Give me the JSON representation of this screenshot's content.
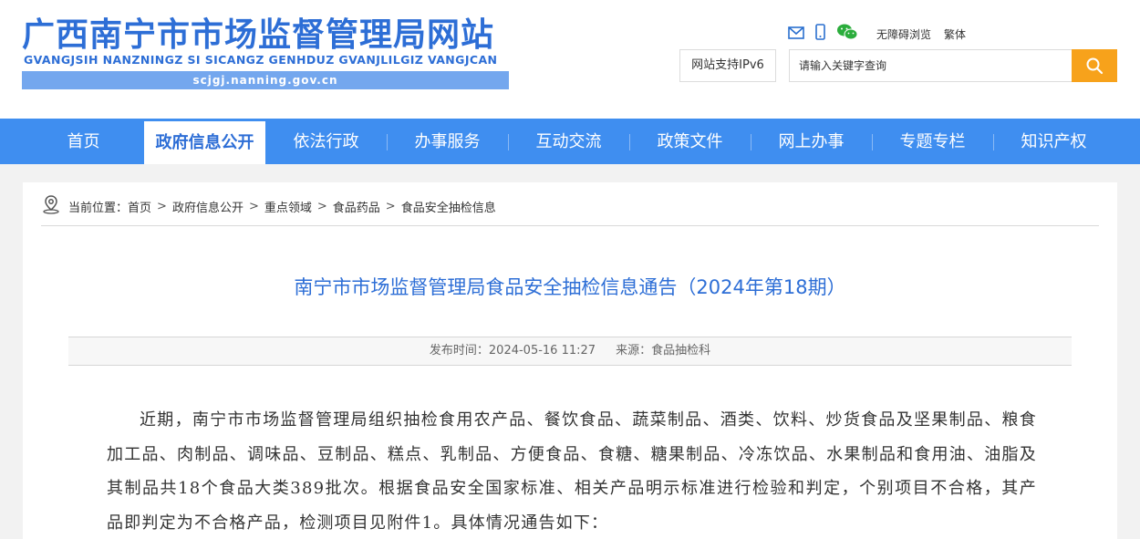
{
  "header": {
    "site_title": "广西南宁市市场监督管理局网站",
    "site_pinyin": "GVANGJSIH NANZNINGZ SI SICANGZ GENHDUZ GVANJLILGIZ VANGJCAN",
    "site_domain": "scjgj.nanning.gov.cn",
    "icons": [
      "mail-icon",
      "mobile-icon",
      "wechat-icon"
    ],
    "accessibility_label": "无障碍浏览",
    "traditional_label": "繁体",
    "ipv6_label": "网站支持IPv6",
    "search_placeholder": "请输入关键字查询"
  },
  "nav": {
    "items": [
      {
        "label": "首页",
        "active": false
      },
      {
        "label": "政府信息公开",
        "active": true
      },
      {
        "label": "依法行政",
        "active": false
      },
      {
        "label": "办事服务",
        "active": false
      },
      {
        "label": "互动交流",
        "active": false
      },
      {
        "label": "政策文件",
        "active": false
      },
      {
        "label": "网上办事",
        "active": false
      },
      {
        "label": "专题专栏",
        "active": false
      },
      {
        "label": "知识产权",
        "active": false
      }
    ]
  },
  "breadcrumb": {
    "prefix": "当前位置：",
    "items": [
      "首页",
      "政府信息公开",
      "重点领域",
      "食品药品",
      "食品安全抽检信息"
    ]
  },
  "article": {
    "title": "南宁市市场监督管理局食品安全抽检信息通告（2024年第18期）",
    "publish_label": "发布时间：",
    "publish_time": "2024-05-16 11:27",
    "source_label": "来源：",
    "source": "食品抽检科",
    "body": "近期，南宁市市场监督管理局组织抽检食用农产品、餐饮食品、蔬菜制品、酒类、饮料、炒货食品及坚果制品、粮食加工品、肉制品、调味品、豆制品、糕点、乳制品、方便食品、食糖、糖果制品、冷冻饮品、水果制品和食用油、油脂及其制品共18个食品大类389批次。根据食品安全国家标准、相关产品明示标准进行检验和判定，个别项目不合格，其产品即判定为不合格产品，检测项目见附件1。具体情况通告如下："
  },
  "colors": {
    "brand_blue": "#2d6ed6",
    "nav_blue": "#3f8ef0",
    "search_orange": "#f7a21b"
  }
}
